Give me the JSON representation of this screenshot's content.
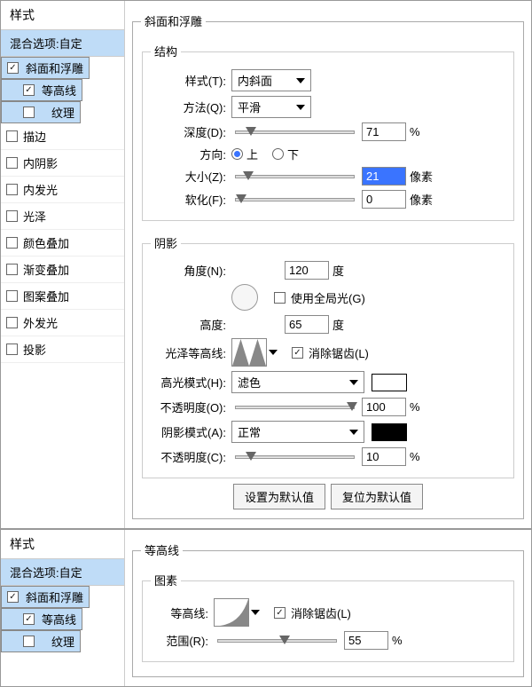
{
  "panel1": {
    "style_header": "样式",
    "blend_header": "混合选项:自定",
    "items": [
      {
        "label": "斜面和浮雕",
        "checked": true,
        "sel": true
      },
      {
        "label": "等高线",
        "checked": true,
        "sel": true,
        "child": true
      },
      {
        "label": "纹理",
        "checked": false,
        "sel": true,
        "child": true
      },
      {
        "label": "描边",
        "checked": false
      },
      {
        "label": "内阴影",
        "checked": false
      },
      {
        "label": "内发光",
        "checked": false
      },
      {
        "label": "光泽",
        "checked": false
      },
      {
        "label": "颜色叠加",
        "checked": false
      },
      {
        "label": "渐变叠加",
        "checked": false
      },
      {
        "label": "图案叠加",
        "checked": false
      },
      {
        "label": "外发光",
        "checked": false
      },
      {
        "label": "投影",
        "checked": false
      }
    ],
    "main_title": "斜面和浮雕",
    "struct_title": "结构",
    "style_label": "样式(T):",
    "style_value": "内斜面",
    "method_label": "方法(Q):",
    "method_value": "平滑",
    "depth_label": "深度(D):",
    "depth_value": "71",
    "pct": "%",
    "dir_label": "方向:",
    "dir_up": "上",
    "dir_down": "下",
    "size_label": "大小(Z):",
    "size_value": "21",
    "px": "像素",
    "soften_label": "软化(F):",
    "soften_value": "0",
    "shading_title": "阴影",
    "angle_label": "角度(N):",
    "angle_value": "120",
    "deg": "度",
    "global_light": "使用全局光(G)",
    "altitude_label": "高度:",
    "altitude_value": "65",
    "gloss_label": "光泽等高线:",
    "antialias": "消除锯齿(L)",
    "hi_mode_label": "高光模式(H):",
    "hi_mode_value": "滤色",
    "hi_opacity_label": "不透明度(O):",
    "hi_opacity_value": "100",
    "sh_mode_label": "阴影模式(A):",
    "sh_mode_value": "正常",
    "sh_opacity_label": "不透明度(C):",
    "sh_opacity_value": "10",
    "btn_default": "设置为默认值",
    "btn_reset": "复位为默认值"
  },
  "panel2": {
    "style_header": "样式",
    "blend_header": "混合选项:自定",
    "items": [
      {
        "label": "斜面和浮雕",
        "checked": true,
        "sel": true
      },
      {
        "label": "等高线",
        "checked": true,
        "sel": true,
        "child": true
      },
      {
        "label": "纹理",
        "checked": false,
        "sel": true,
        "child": true
      }
    ],
    "main_title": "等高线",
    "elem_title": "图素",
    "contour_label": "等高线:",
    "antialias": "消除锯齿(L)",
    "range_label": "范围(R):",
    "range_value": "55",
    "pct": "%"
  }
}
